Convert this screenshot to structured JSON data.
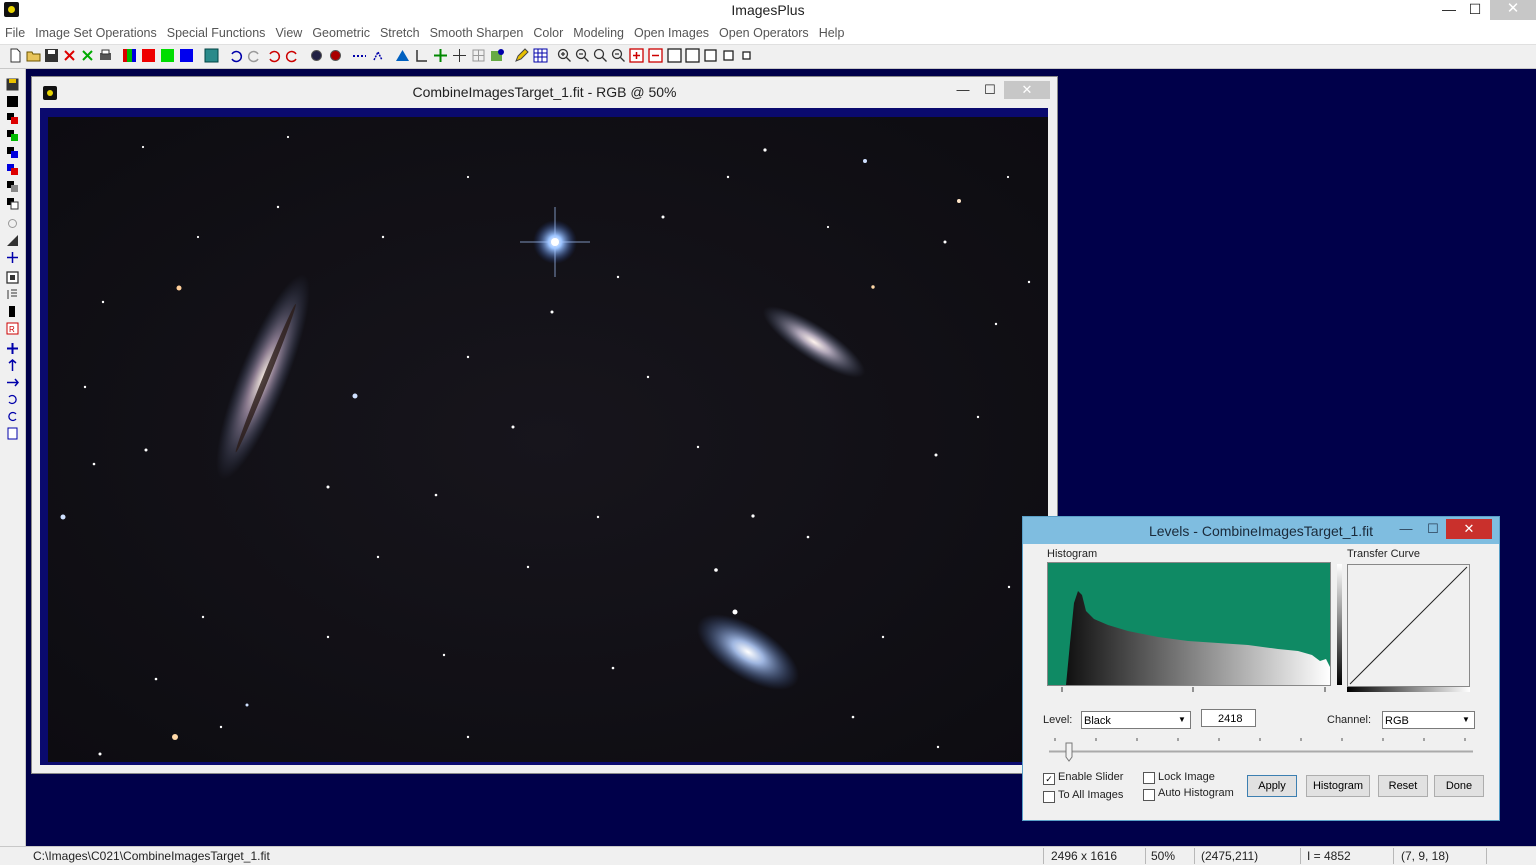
{
  "app": {
    "title": "ImagesPlus"
  },
  "window_controls": {
    "minimize": "—",
    "maximize": "☐",
    "close": "✕"
  },
  "menu": [
    "File",
    "Image Set Operations",
    "Special Functions",
    "View",
    "Geometric",
    "Stretch",
    "Smooth Sharpen",
    "Color",
    "Modeling",
    "Open Images",
    "Open Operators",
    "Help"
  ],
  "colors": {
    "workspace": "#00004a",
    "histogram_bg": "#0f8a64",
    "levels_titlebar": "#7fbde0",
    "close_red": "#c9302c"
  },
  "image_window": {
    "title": "CombineImagesTarget_1.fit - RGB @ 50%"
  },
  "levels": {
    "title": "Levels - CombineImagesTarget_1.fit",
    "histogram_label": "Histogram",
    "curve_label": "Transfer Curve",
    "level_label": "Level:",
    "level_value": "Black",
    "input_value": "2418",
    "channel_label": "Channel:",
    "channel_value": "RGB",
    "enable_slider": "Enable Slider",
    "to_all_images": "To All Images",
    "lock_image": "Lock Image",
    "auto_histogram": "Auto Histogram",
    "enable_slider_checked": true,
    "buttons": {
      "apply": "Apply",
      "histogram": "Histogram",
      "reset": "Reset",
      "done": "Done"
    }
  },
  "status": {
    "path": "C:\\Images\\C021\\CombineImagesTarget_1.fit",
    "dimensions": "2496 x 1616",
    "zoom": "50%",
    "cursor": "(2475,211)",
    "intensity": "I = 4852",
    "rgb": "(7, 9, 18)"
  }
}
